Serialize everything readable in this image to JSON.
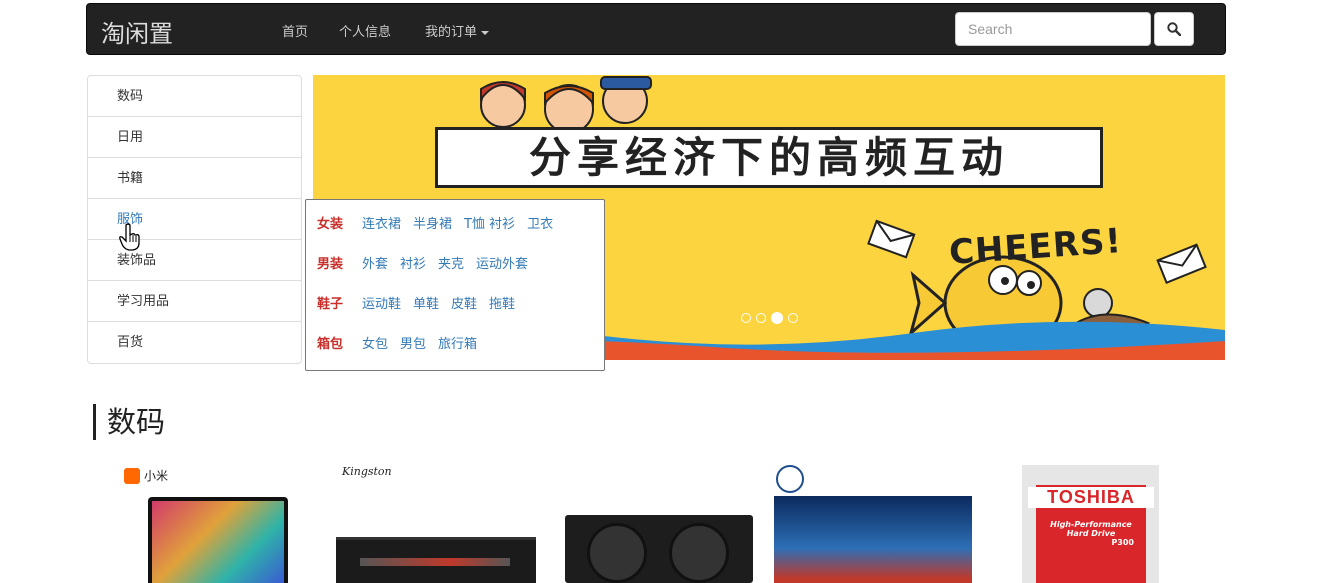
{
  "navbar": {
    "brand": "淘闲置",
    "links": [
      "首页",
      "个人信息"
    ],
    "dropdown": "我的订单",
    "search_placeholder": "Search"
  },
  "categories": [
    {
      "label": "数码",
      "active": false
    },
    {
      "label": "日用",
      "active": false
    },
    {
      "label": "书籍",
      "active": false
    },
    {
      "label": "服饰",
      "active": true
    },
    {
      "label": "装饰品",
      "active": false
    },
    {
      "label": "学习用品",
      "active": false
    },
    {
      "label": "百货",
      "active": false
    }
  ],
  "carousel": {
    "title": "分享经济下的高频互动",
    "slogan": "CHEERS!",
    "slide_count": 4,
    "active_slide": 3
  },
  "flyout": [
    {
      "head": "女装",
      "links": [
        "连衣裙",
        "半身裙",
        "T恤 衬衫",
        "卫衣"
      ]
    },
    {
      "head": "男装",
      "links": [
        "外套",
        "衬衫",
        "夹克",
        "运动外套"
      ]
    },
    {
      "head": "鞋子",
      "links": [
        "运动鞋",
        "单鞋",
        "皮鞋",
        "拖鞋"
      ]
    },
    {
      "head": "箱包",
      "links": [
        "女包",
        "男包",
        "旅行箱"
      ]
    }
  ],
  "section": {
    "title": "数码"
  },
  "products": [
    {
      "brand": "小米",
      "type": "laptop"
    },
    {
      "brand": "Kingston",
      "type": "memory"
    },
    {
      "brand": "",
      "type": "gpu"
    },
    {
      "brand": "",
      "type": "monitor"
    },
    {
      "brand": "TOSHIBA",
      "type": "hdd",
      "subtitle": "High-Performance Hard Drive",
      "model": "P300"
    }
  ],
  "colors": {
    "navbar": "#222222",
    "link": "#337ab7",
    "flyout_head": "#c9302c",
    "banner": "#fcd43f"
  }
}
